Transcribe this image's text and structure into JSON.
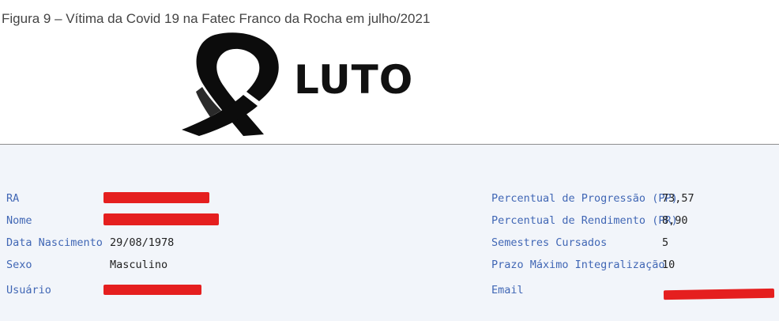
{
  "caption": "Figura 9 – Vítima da Covid 19 na Fatec Franco da Rocha em julho/2021",
  "logo": {
    "word": "LUTO",
    "icon": "black-mourning-ribbon"
  },
  "colors": {
    "label": "#4167b5",
    "value": "#222222",
    "panel_bg": "#f2f5fa",
    "redaction": "#e51f1f",
    "caption": "#444444"
  },
  "left_fields": [
    {
      "label": "RA",
      "value": "",
      "redacted": true
    },
    {
      "label": "Nome",
      "value": "",
      "redacted": true
    },
    {
      "label": "Data Nascimento",
      "value": "29/08/1978",
      "redacted": false
    },
    {
      "label": "Sexo",
      "value": "Masculino",
      "redacted": false
    },
    {
      "label": "Usuário",
      "value": "",
      "redacted": true
    }
  ],
  "right_fields": [
    {
      "label": "Percentual de Progressão (PP)",
      "value": "73,57",
      "redacted": false
    },
    {
      "label": "Percentual de Rendimento (PR)",
      "value": "8,90",
      "redacted": false
    },
    {
      "label": "Semestres Cursados",
      "value": "5",
      "redacted": false
    },
    {
      "label": "Prazo Máximo Integralização",
      "value": "10",
      "redacted": false
    },
    {
      "label": "Email",
      "value": "",
      "redacted": true
    }
  ]
}
